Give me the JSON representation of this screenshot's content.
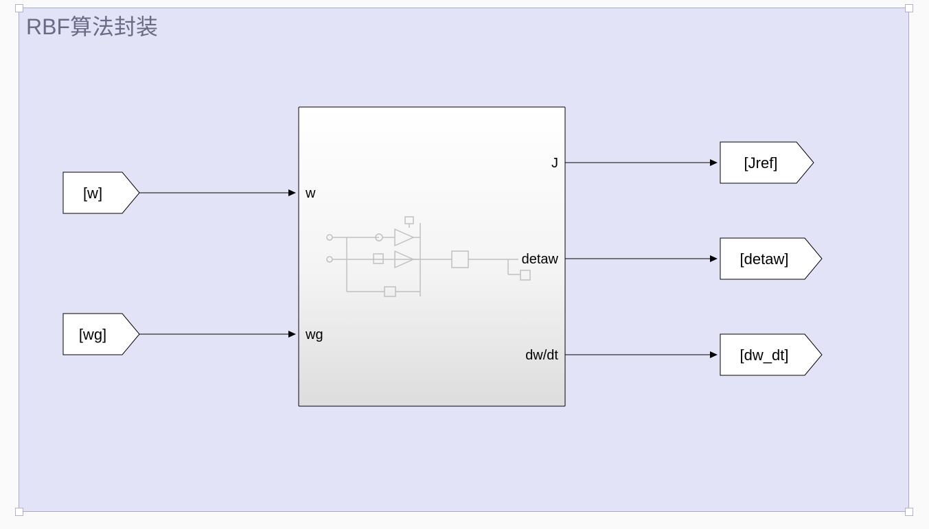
{
  "area": {
    "title": "RBF算法封装"
  },
  "from_blocks": {
    "w": "[w]",
    "wg": "[wg]"
  },
  "subsystem": {
    "in1": "w",
    "in2": "wg",
    "out1": "J",
    "out2": "detaw",
    "out3": "dw/dt"
  },
  "goto_blocks": {
    "jref": "[Jref]",
    "detaw": "[detaw]",
    "dw_dt": "[dw_dt]"
  }
}
